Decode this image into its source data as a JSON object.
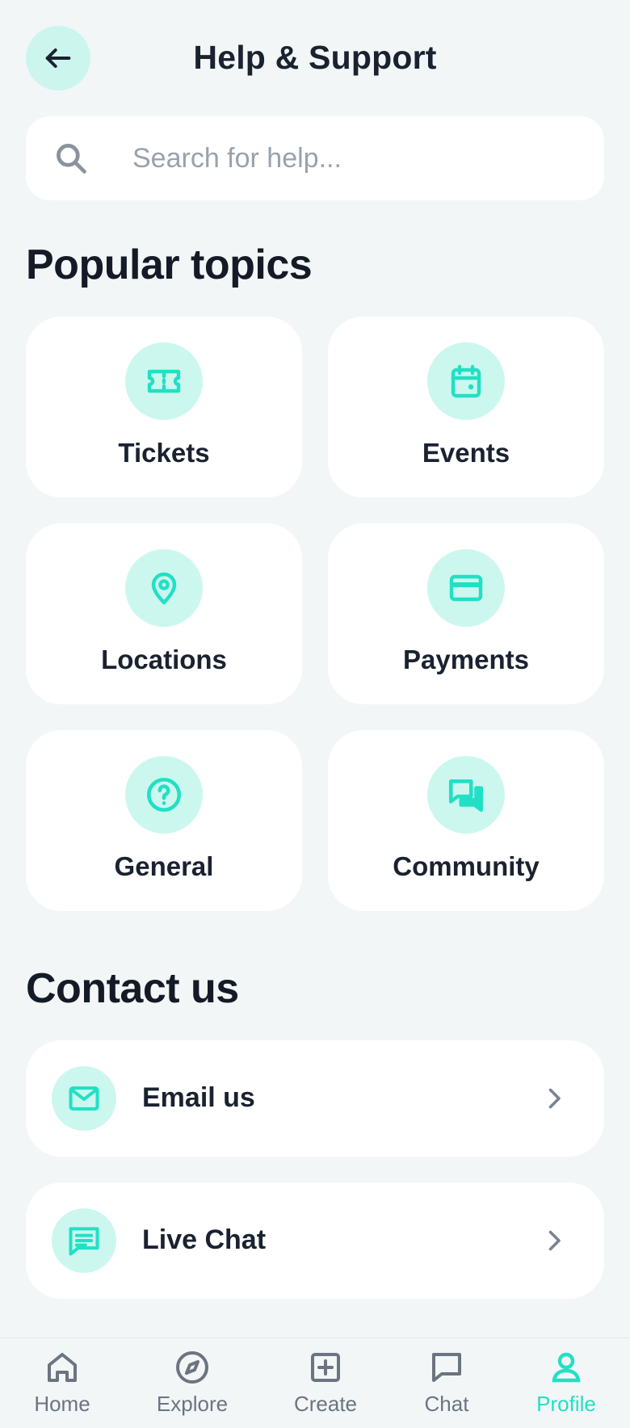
{
  "header": {
    "title": "Help & Support"
  },
  "search": {
    "placeholder": "Search for help..."
  },
  "sections": {
    "popular": "Popular topics",
    "contact": "Contact us"
  },
  "topics": [
    {
      "label": "Tickets",
      "icon": "ticket-icon"
    },
    {
      "label": "Events",
      "icon": "calendar-icon"
    },
    {
      "label": "Locations",
      "icon": "map-pin-icon"
    },
    {
      "label": "Payments",
      "icon": "credit-card-icon"
    },
    {
      "label": "General",
      "icon": "question-circle-icon"
    },
    {
      "label": "Community",
      "icon": "chat-bubbles-icon"
    }
  ],
  "contact": [
    {
      "label": "Email us",
      "icon": "mail-icon"
    },
    {
      "label": "Live Chat",
      "icon": "message-icon"
    }
  ],
  "nav": [
    {
      "label": "Home",
      "icon": "home-icon"
    },
    {
      "label": "Explore",
      "icon": "compass-icon"
    },
    {
      "label": "Create",
      "icon": "plus-square-icon"
    },
    {
      "label": "Chat",
      "icon": "chat-icon"
    },
    {
      "label": "Profile",
      "icon": "user-icon",
      "active": true
    }
  ],
  "colors": {
    "accent": "#21e0c4",
    "accent_soft": "#ccf7ef",
    "background": "#f2f6f7",
    "text": "#1a2230",
    "muted": "#6b7480"
  }
}
